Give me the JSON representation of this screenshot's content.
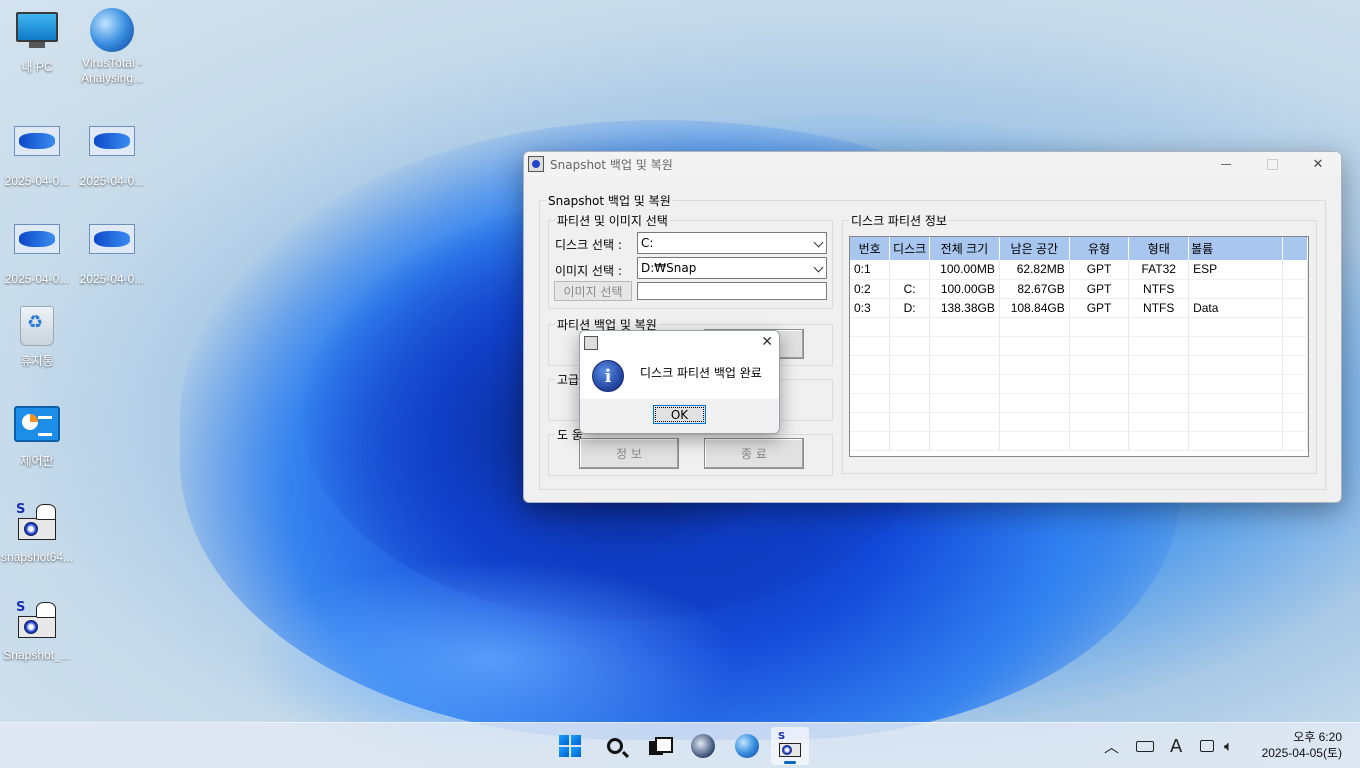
{
  "desktop": {
    "icons": [
      {
        "label": "내 PC"
      },
      {
        "label": "VirusTotal - Analysing..."
      },
      {
        "label": "2025-04-0..."
      },
      {
        "label": "2025-04-0..."
      },
      {
        "label": "2025-04-0..."
      },
      {
        "label": "2025-04-0..."
      },
      {
        "label": "휴지통"
      },
      {
        "label": "제어판"
      },
      {
        "label": "snapshot64..."
      },
      {
        "label": "Snapshot_..."
      }
    ]
  },
  "window": {
    "title": "Snapshot 백업 및 복원",
    "outer_group": "Snapshot 백업 및 복원",
    "partition_group": "파티션 및 이미지 선택",
    "disk_label": "디스크 선택 :",
    "disk_value": "C:",
    "image_label": "이미지 선택 :",
    "image_value": "D:₩Snap",
    "image_button": "이미지 선택",
    "backup_group": "파티션 백업 및 복원",
    "advanced_group": "고급",
    "help_group": "도 움",
    "info_button": "정    보",
    "exit_button": "종 료",
    "disk_info_group": "디스크 파티션 정보",
    "table": {
      "headers": [
        "번호",
        "디스크",
        "전체 크기",
        "남은 공간",
        "유형",
        "형태",
        "볼륨"
      ],
      "rows": [
        [
          "0:1",
          "",
          "100.00MB",
          "62.82MB",
          "GPT",
          "FAT32",
          "ESP"
        ],
        [
          "0:2",
          "C:",
          "100.00GB",
          "82.67GB",
          "GPT",
          "NTFS",
          ""
        ],
        [
          "0:3",
          "D:",
          "138.38GB",
          "108.84GB",
          "GPT",
          "NTFS",
          "Data"
        ]
      ]
    }
  },
  "dialog": {
    "message": "디스크 파티션 백업 완료",
    "ok": "OK"
  },
  "taskbar": {
    "time": "오후 6:20",
    "date": "2025-04-05(토)",
    "ime": "A"
  }
}
